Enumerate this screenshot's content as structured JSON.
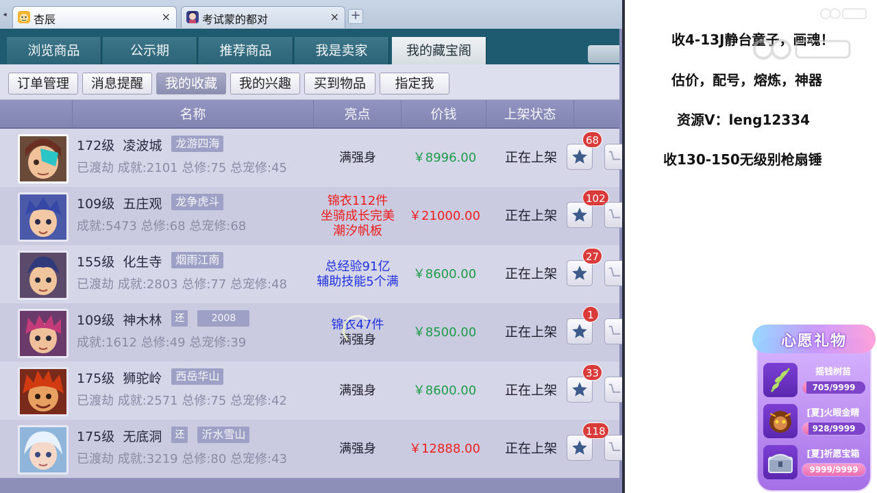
{
  "browser": {
    "tabs": [
      {
        "title": "杏辰",
        "close": "×"
      },
      {
        "title": "考试蒙的都对",
        "close": "×"
      }
    ],
    "new_tab": "+",
    "tab_scroll": "◂"
  },
  "game": {
    "nav_tabs": [
      "浏览商品",
      "公示期",
      "推荐商品",
      "我是卖家",
      "我的藏宝阁"
    ],
    "active_nav_tab": "我的藏宝阁",
    "sub_tabs": [
      "订单管理",
      "消息提醒",
      "我的收藏",
      "我的兴趣",
      "买到物品",
      "指定我"
    ],
    "active_sub_tab": "我的收藏",
    "columns": {
      "name": "名称",
      "highlight": "亮点",
      "price": "价钱",
      "status": "上架状态"
    },
    "rows": [
      {
        "level": "172级",
        "school": "凌波城",
        "server": "龙游四海",
        "huan": "",
        "year": "",
        "stats": "已渡劫 成就:2101 总修:75 总宠修:45",
        "highlight": [
          "满强身"
        ],
        "highlight_color": "black",
        "price": "￥8996.00",
        "price_color": "green",
        "status": "正在上架",
        "fav_count": "68"
      },
      {
        "level": "109级",
        "school": "五庄观",
        "server": "龙争虎斗",
        "huan": "",
        "year": "",
        "stats": "成就:5473 总修:68 总宠修:68",
        "highlight": [
          "锦衣112件",
          "坐骑成长完美",
          "潮汐帆板"
        ],
        "highlight_color": "red",
        "price": "￥21000.00",
        "price_color": "red",
        "status": "正在上架",
        "fav_count": "102"
      },
      {
        "level": "155级",
        "school": "化生寺",
        "server": "烟雨江南",
        "huan": "",
        "year": "",
        "stats": "已渡劫 成就:2803 总修:77 总宠修:48",
        "highlight": [
          "总经验91亿",
          "辅助技能5个满"
        ],
        "highlight_color": "blue",
        "price": "￥8600.00",
        "price_color": "green",
        "status": "正在上架",
        "fav_count": "27"
      },
      {
        "level": "109级",
        "school": "神木林",
        "server": "",
        "huan": "还",
        "year": "2008",
        "stats": "成就:1612 总修:49 总宠修:39",
        "highlight": [
          "锦衣47件",
          "满强身"
        ],
        "highlight_color": "mixed",
        "price": "￥8500.00",
        "price_color": "green",
        "status": "正在上架",
        "fav_count": "1"
      },
      {
        "level": "175级",
        "school": "狮驼岭",
        "server": "西岳华山",
        "huan": "",
        "year": "",
        "stats": "已渡劫 成就:2571 总修:75 总宠修:42",
        "highlight": [
          "满强身"
        ],
        "highlight_color": "black",
        "price": "￥8600.00",
        "price_color": "green",
        "status": "正在上架",
        "fav_count": "33"
      },
      {
        "level": "175级",
        "school": "无底洞",
        "server": "沂水雪山",
        "huan": "还",
        "year": "",
        "stats": "已渡劫 成就:3219 总修:80 总宠修:43",
        "highlight": [
          "满强身"
        ],
        "highlight_color": "black",
        "price": "￥12888.00",
        "price_color": "red",
        "status": "正在上架",
        "fav_count": "118"
      }
    ]
  },
  "overlay": {
    "lines": [
      "收4-13J静台童子，画魂！",
      "估价，配号，熔炼，神器",
      "资源V：leng12334",
      "收130-150无级别枪扇锤"
    ]
  },
  "wish": {
    "title": "心愿礼物",
    "gifts": [
      {
        "name": "摇钱树苗",
        "count": "705/9999",
        "progress": 0.0705
      },
      {
        "name": "[夏]火眼金睛",
        "count": "928/9999",
        "progress": 0.0928
      },
      {
        "name": "[夏]祈愿宝箱",
        "count": "9999/9999",
        "progress": 1.0
      }
    ]
  },
  "colors": {
    "nav_bg": "#1e5a70",
    "row_odd": "#d6d6e9",
    "row_even": "#cacae0",
    "price_green": "#1c9b48",
    "price_red": "#ef1e1e",
    "badge_red": "#d93b3b"
  }
}
